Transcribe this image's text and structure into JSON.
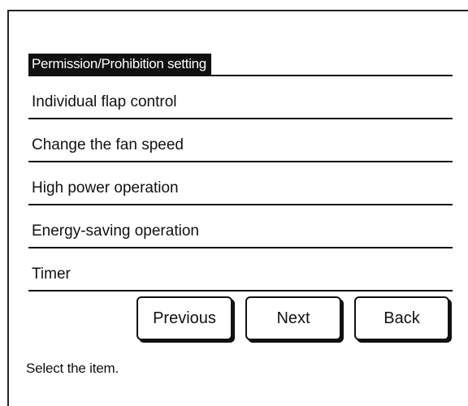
{
  "screen": {
    "title": "Permission/Prohibition setting",
    "items": [
      {
        "label": "Individual flap control"
      },
      {
        "label": "Change the fan speed"
      },
      {
        "label": "High power operation"
      },
      {
        "label": "Energy-saving operation"
      },
      {
        "label": "Timer"
      }
    ]
  },
  "buttons": {
    "previous": "Previous",
    "next": "Next",
    "back": "Back"
  },
  "status": {
    "message": "Select the item."
  }
}
